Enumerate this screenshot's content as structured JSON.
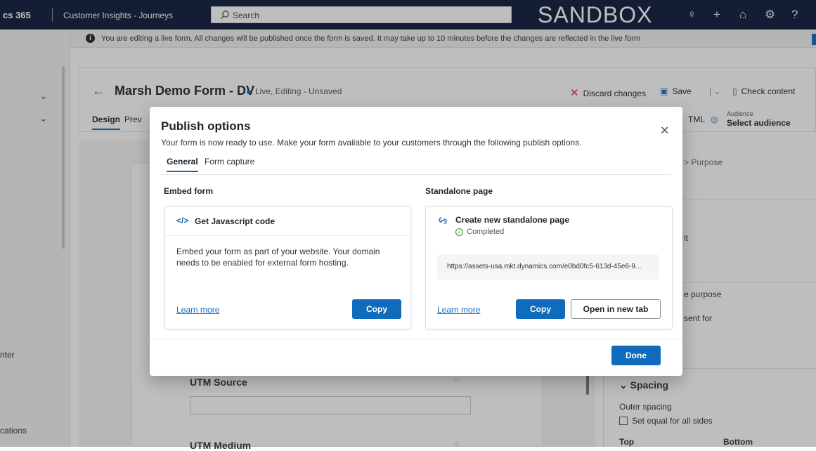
{
  "topbar": {
    "app_name": "cs 365",
    "area_name": "Customer Insights - Journeys",
    "search_placeholder": "Search",
    "environment": "SANDBOX",
    "icons": [
      "lightbulb-icon",
      "plus-icon",
      "bell-icon",
      "gear-icon",
      "help-icon"
    ],
    "icon_glyphs": [
      "♀",
      "+",
      "⌂",
      "⚙",
      "?"
    ]
  },
  "leftnav": {
    "items": [
      "nter",
      "cations"
    ]
  },
  "infobar": {
    "message": "You are editing a live form. All changes will be published once the form is saved. It may take up to 10 minutes before the changes are reflected in the live form"
  },
  "page": {
    "title": "Marsh Demo Form - DV",
    "status": "Live, Editing - Unsaved",
    "commands": {
      "discard": "Discard changes",
      "save": "Save",
      "check": "Check content"
    },
    "tabs": [
      "Design",
      "Prev"
    ],
    "html_label": "TML",
    "audience_label": "Audience",
    "audience_value": "Select audience"
  },
  "canvas": {
    "labels": [
      "UTM Source",
      "UTM Medium"
    ]
  },
  "right_panel": {
    "breadcrumb": "> Purpose",
    "items": [
      "lt",
      "e purpose",
      "sent for"
    ],
    "spacing_heading": "Spacing",
    "outer_spacing": "Outer spacing",
    "equal_sides": "Set equal for all sides",
    "top": "Top",
    "bottom": "Bottom"
  },
  "dialog": {
    "title": "Publish options",
    "subtitle": "Your form is now ready to use. Make your form available to your customers through the following publish options.",
    "tabs": [
      "General",
      "Form capture"
    ],
    "embed": {
      "heading": "Embed form",
      "card_icon": "</>",
      "card_title": "Get Javascript code",
      "description": "Embed your form as part of your website. Your domain needs to be enabled for external form hosting.",
      "learn_more": "Learn more",
      "copy": "Copy"
    },
    "standalone": {
      "heading": "Standalone page",
      "card_title": "Create new standalone page",
      "status": "Completed",
      "url": "https://assets-usa.mkt.dynamics.com/e0bd0fc5-613d-45e6-9...",
      "learn_more": "Learn more",
      "copy": "Copy",
      "open": "Open in new tab"
    },
    "done": "Done"
  },
  "colors": {
    "accent": "#0f6cbd",
    "topbar": "#0b1a3a"
  }
}
